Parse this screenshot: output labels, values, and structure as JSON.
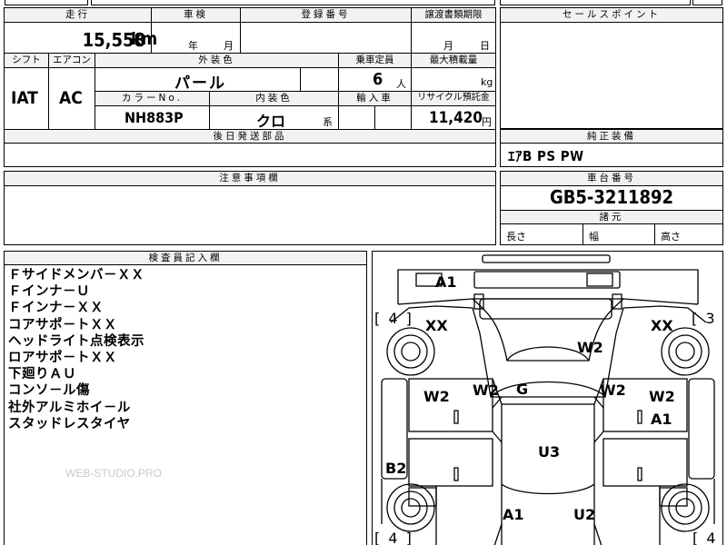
{
  "header": {
    "mileage_label": "走行",
    "mileage_value": "15,558",
    "mileage_unit": "km",
    "inspection_label": "車検",
    "inspection_year": "年",
    "inspection_month": "月",
    "registration_label": "登録番号",
    "transfer_deadline_label": "譲渡書類期限",
    "transfer_month": "月",
    "transfer_day": "日"
  },
  "row2": {
    "shift_label": "シフト",
    "shift_value": "IAT",
    "aircon_label": "エアコン",
    "aircon_value": "AC",
    "exterior_color_label": "外装色",
    "exterior_color_value": "パール",
    "capacity_label": "乗車定員",
    "capacity_value": "6",
    "capacity_unit": "人",
    "max_load_label": "最大積載量",
    "max_load_unit": "kg",
    "color_no_label": "カラーNo.",
    "color_no_value": "NH883P",
    "interior_color_label": "内装色",
    "interior_color_value": "クロ",
    "interior_color_suffix": "系",
    "import_label": "輸入車",
    "recycle_label": "リサイクル預託金",
    "recycle_value": "11,420",
    "recycle_unit": "円"
  },
  "later_parts_label": "後日発送部品",
  "notes_label": "注意事項欄",
  "sales_point_label": "セールスポイント",
  "equipment": {
    "label": "純正装備",
    "value": "ｴｱB PS PW"
  },
  "chassis": {
    "label": "車台番号",
    "value": "GB5-3211892"
  },
  "dimensions": {
    "label": "諸元",
    "length_label": "長さ",
    "width_label": "幅",
    "height_label": "高さ"
  },
  "inspector": {
    "label": "検査員記入欄",
    "remarks": [
      "Ｆサイドメンバ－ＸＸ",
      "Ｆインナ－Ｕ",
      "Ｆインナ－ＸＸ",
      "コアサポ－トＸＸ",
      "ヘッドライト点検表示",
      "ロアサポ－トＸＸ",
      "下廻りＡＵ",
      "コンソ－ル傷",
      "社外アルミホイ－ル",
      "スタッドレスタイヤ"
    ]
  },
  "watermark": "WEB-STUDIO.PRO",
  "diagram": {
    "bracket_left_top": "[ 4 ]",
    "bracket_right_top": "[ 3 ]",
    "bracket_left_bottom": "[ 4 ]",
    "bracket_right_bottom": "[ 4",
    "marks": {
      "a1_top": "A1",
      "xx_left": "XX",
      "xx_right": "XX",
      "w2_hood": "W2",
      "w2_left_fender": "W2",
      "w2_left_pillar": "W2",
      "g_windshield": "G",
      "w2_right_pillar": "W2",
      "w2_right_door": "W2",
      "a1_right_door": "A1",
      "u3_roof": "U3",
      "b2_left_rear": "B2",
      "a1_rear": "A1",
      "u2_rear": "U2"
    }
  }
}
